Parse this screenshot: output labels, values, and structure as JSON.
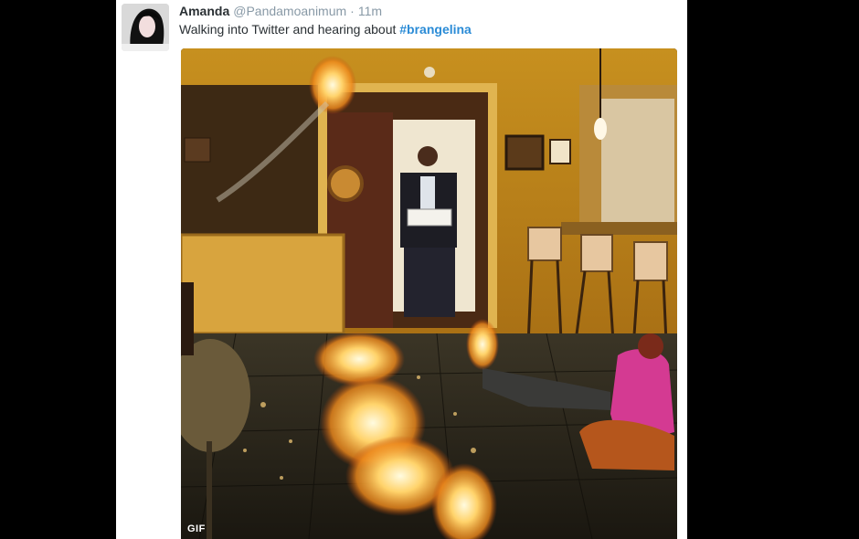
{
  "tweet": {
    "display_name": "Amanda",
    "username": "@Pandamoanimum",
    "separator": "·",
    "timestamp": "11m",
    "text_before": "Walking into Twitter and hearing about ",
    "hashtag": "#brangelina",
    "media": {
      "badge": "GIF",
      "description_icon": "gif-media"
    },
    "avatar_icon": "user-avatar"
  },
  "colors": {
    "background": "#000000",
    "card": "#ffffff",
    "name": "#292f33",
    "meta": "#8899a6",
    "link": "#2a8bd6"
  }
}
